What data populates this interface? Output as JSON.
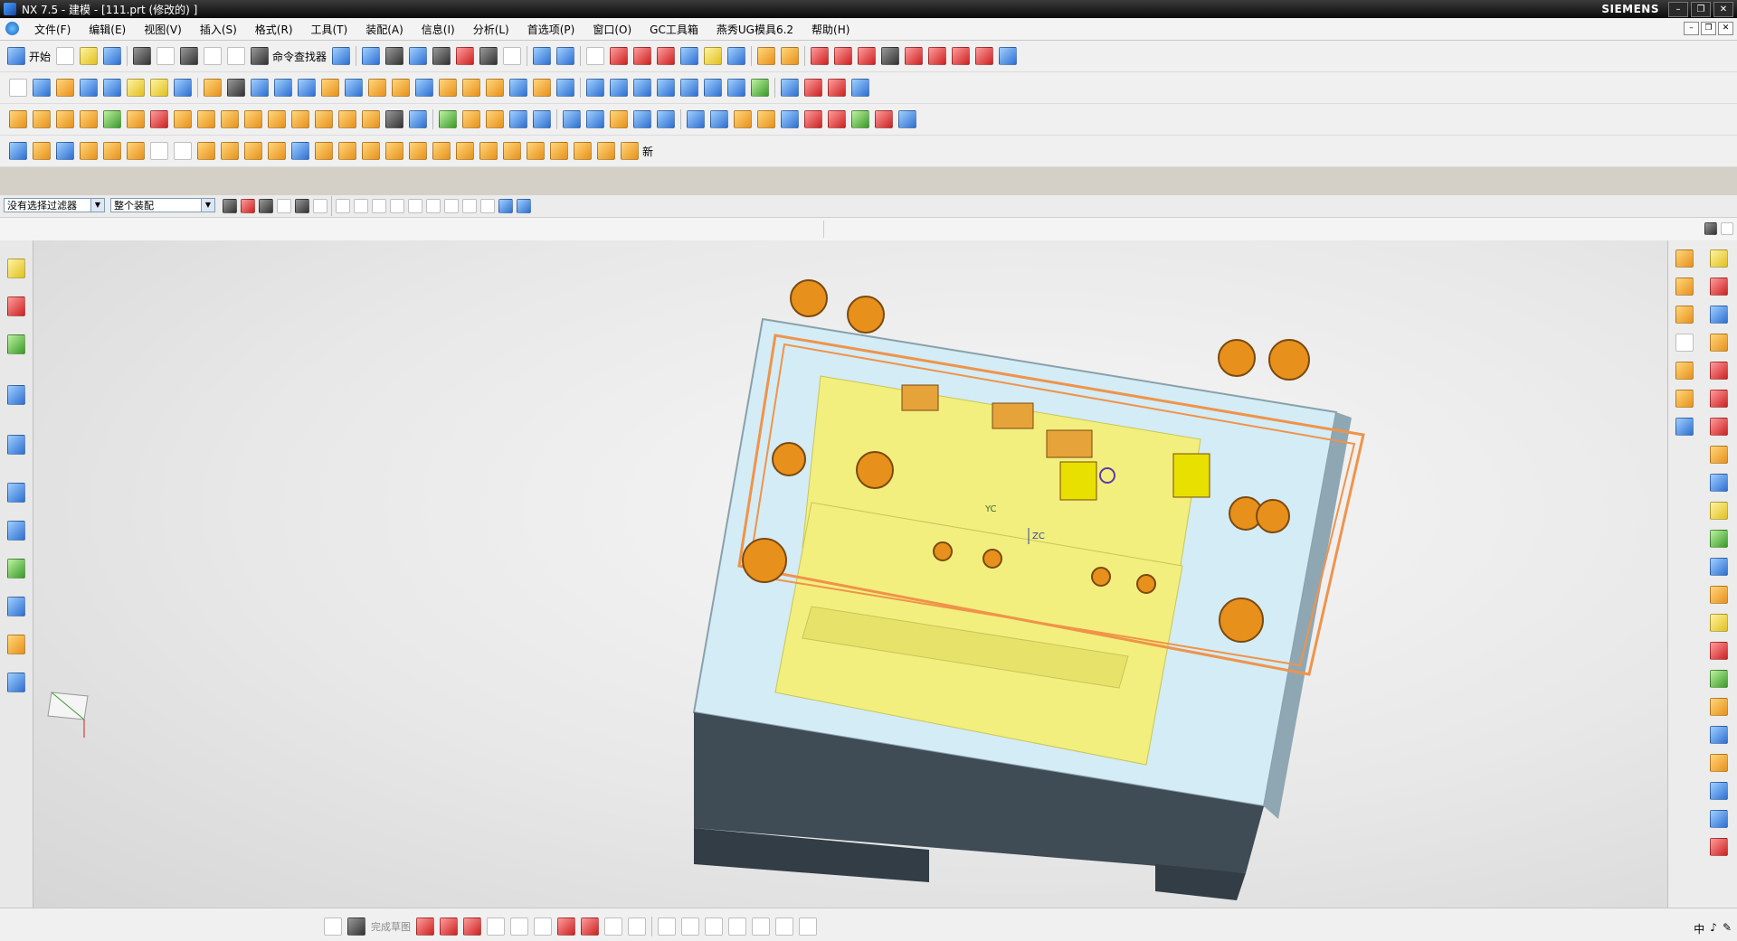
{
  "window": {
    "title": "NX 7.5 - 建模 - [111.prt  (修改的) ]",
    "brand": "SIEMENS",
    "controls": [
      "–",
      "❐",
      "✕"
    ]
  },
  "menu": {
    "items": [
      "文件(F)",
      "编辑(E)",
      "视图(V)",
      "插入(S)",
      "格式(R)",
      "工具(T)",
      "装配(A)",
      "信息(I)",
      "分析(L)",
      "首选项(P)",
      "窗口(O)",
      "GC工具箱",
      "燕秀UG模具6.2",
      "帮助(H)"
    ],
    "mdi_controls": [
      "–",
      "❐",
      "✕"
    ]
  },
  "toolbar": {
    "start_label": "开始",
    "command_finder_label": "命令查找器",
    "new_label": "新"
  },
  "selection_bar": {
    "filter_value": "没有选择过滤器",
    "scope_value": "整个装配"
  },
  "viewport": {
    "wcs_yc": "YC",
    "wcs_zc": "ZC",
    "colors": {
      "plate_yellow": "#f2ef7e",
      "base_dark": "#3f4b55",
      "frame_light": "#d3ecf5",
      "hole_orange": "#e8901c",
      "highlight": "#f0934a",
      "frame_side": "#8fa7b3"
    }
  },
  "sketch_bar": {
    "finish_label": "完成草图"
  },
  "statusbar": {
    "ime": [
      "中",
      "♪",
      "✎"
    ]
  }
}
